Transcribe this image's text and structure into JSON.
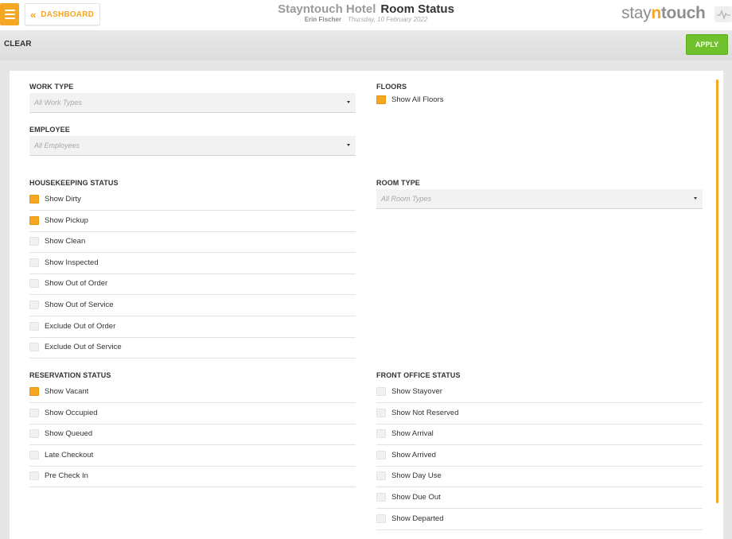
{
  "header": {
    "dashboard_label": "DASHBOARD",
    "hotel_name": "Stayntouch Hotel",
    "page_title": "Room Status",
    "user_name": "Erin Fischer",
    "date": "Thursday, 10 February 2022",
    "logo": {
      "part1": "stay",
      "part2": "n",
      "part3": "touch"
    }
  },
  "toolbar": {
    "clear_label": "CLEAR",
    "apply_label": "APPLY"
  },
  "colors": {
    "accent": "#f5a623",
    "apply_green": "#6fc22e"
  },
  "work_type": {
    "title": "WORK TYPE",
    "placeholder": "All Work Types"
  },
  "employee": {
    "title": "EMPLOYEE",
    "placeholder": "All Employees"
  },
  "floors": {
    "title": "FLOORS",
    "option": {
      "label": "Show All Floors",
      "checked": true
    }
  },
  "room_type": {
    "title": "ROOM TYPE",
    "placeholder": "All Room Types"
  },
  "housekeeping": {
    "title": "HOUSEKEEPING STATUS",
    "options": [
      {
        "label": "Show Dirty",
        "checked": true
      },
      {
        "label": "Show Pickup",
        "checked": true
      },
      {
        "label": "Show Clean",
        "checked": false
      },
      {
        "label": "Show Inspected",
        "checked": false
      },
      {
        "label": "Show Out of Order",
        "checked": false
      },
      {
        "label": "Show Out of Service",
        "checked": false
      },
      {
        "label": "Exclude Out of Order",
        "checked": false
      },
      {
        "label": "Exclude Out of Service",
        "checked": false
      }
    ]
  },
  "reservation": {
    "title": "RESERVATION STATUS",
    "options": [
      {
        "label": "Show Vacant",
        "checked": true
      },
      {
        "label": "Show Occupied",
        "checked": false
      },
      {
        "label": "Show Queued",
        "checked": false
      },
      {
        "label": "Late Checkout",
        "checked": false
      },
      {
        "label": "Pre Check In",
        "checked": false
      }
    ]
  },
  "front_office": {
    "title": "FRONT OFFICE STATUS",
    "options": [
      {
        "label": "Show Stayover",
        "checked": false
      },
      {
        "label": "Show Not Reserved",
        "checked": false
      },
      {
        "label": "Show Arrival",
        "checked": false
      },
      {
        "label": "Show Arrived",
        "checked": false
      },
      {
        "label": "Show Day Use",
        "checked": false
      },
      {
        "label": "Show Due Out",
        "checked": false
      },
      {
        "label": "Show Departed",
        "checked": false
      }
    ]
  }
}
